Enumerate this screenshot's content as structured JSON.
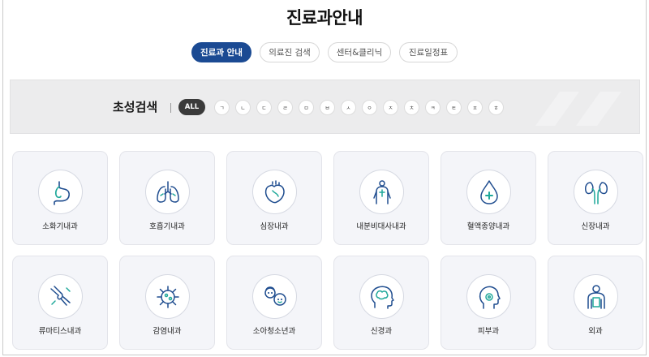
{
  "page": {
    "title": "진료과안내"
  },
  "tabs": [
    {
      "label": "진료과 안내",
      "active": true
    },
    {
      "label": "의료진 검색",
      "active": false
    },
    {
      "label": "센터&클리닉",
      "active": false
    },
    {
      "label": "진료일정표",
      "active": false
    }
  ],
  "initial_search": {
    "title": "초성검색",
    "all_label": "ALL",
    "letters": [
      "ㄱ",
      "ㄴ",
      "ㄷ",
      "ㄹ",
      "ㅁ",
      "ㅂ",
      "ㅅ",
      "ㅇ",
      "ㅈ",
      "ㅊ",
      "ㅋ",
      "ㅌ",
      "ㅍ",
      "ㅎ"
    ]
  },
  "departments": [
    {
      "label": "소화기내과",
      "icon": "stomach-icon"
    },
    {
      "label": "호흡기내과",
      "icon": "lungs-icon"
    },
    {
      "label": "심장내과",
      "icon": "heart-icon"
    },
    {
      "label": "내분비대사내과",
      "icon": "body-metabolism-icon"
    },
    {
      "label": "혈액종양내과",
      "icon": "blood-drop-icon"
    },
    {
      "label": "신장내과",
      "icon": "kidney-icon"
    },
    {
      "label": "류마티스내과",
      "icon": "joint-bone-icon"
    },
    {
      "label": "감염내과",
      "icon": "virus-icon"
    },
    {
      "label": "소아청소년과",
      "icon": "children-icon"
    },
    {
      "label": "신경과",
      "icon": "brain-head-icon"
    },
    {
      "label": "피부과",
      "icon": "face-profile-icon"
    },
    {
      "label": "외과",
      "icon": "patient-body-icon"
    }
  ],
  "colors": {
    "accent": "#1b4a93",
    "icon_blue": "#1f4d8f",
    "icon_teal": "#1fa89a",
    "chip_active": "#3a3a3a"
  }
}
